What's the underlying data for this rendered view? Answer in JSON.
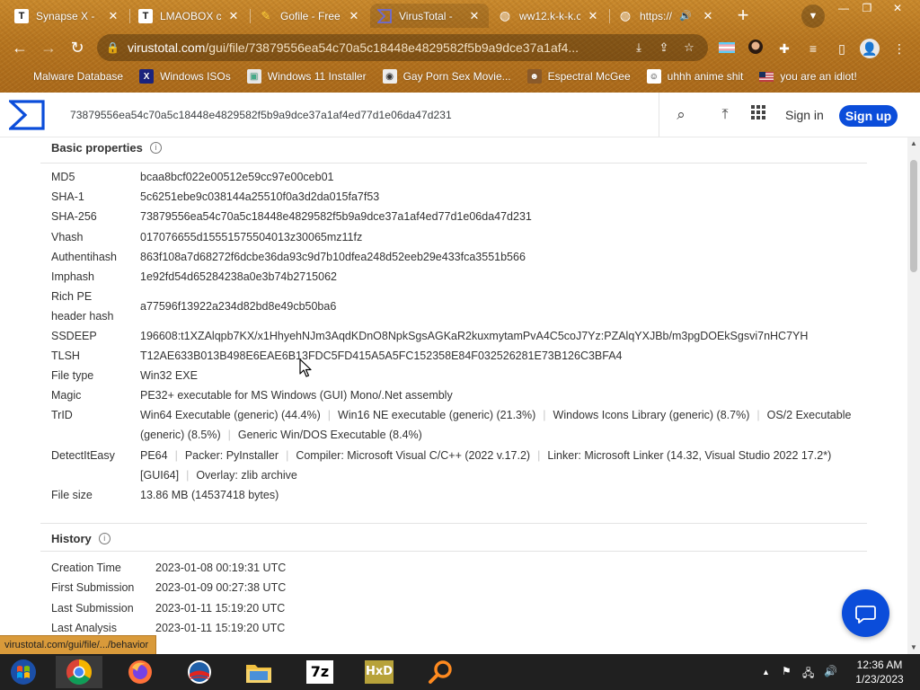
{
  "browser": {
    "tabs": [
      {
        "title": "Synapse X -",
        "favicon": "T"
      },
      {
        "title": "LMAOBOX c",
        "favicon": "T"
      },
      {
        "title": "Gofile - Free",
        "favicon": "gofile-icon"
      },
      {
        "title": "VirusTotal -",
        "favicon": "virustotal-icon"
      },
      {
        "title": "ww12.k-k-k.c",
        "favicon": "globe-icon"
      },
      {
        "title": "https://",
        "favicon": "globe-icon"
      }
    ],
    "url_host": "virustotal.com",
    "url_path": "/gui/file/73879556ea54c70a5c18448e4829582f5b9a9dce37a1af4...",
    "bookmarks": [
      {
        "label": "Malware Database",
        "icon": "folder-icon"
      },
      {
        "label": "Windows ISOs",
        "icon": "x-icon"
      },
      {
        "label": "Windows 11 Installer",
        "icon": "image-icon"
      },
      {
        "label": "Gay Porn Sex Movie...",
        "icon": "site-icon"
      },
      {
        "label": "Espectral McGee",
        "icon": "site-icon"
      },
      {
        "label": "uhhh anime shit",
        "icon": "site-icon"
      },
      {
        "label": "you are an idiot!",
        "icon": "flag-icon"
      }
    ],
    "status_url": "virustotal.com/gui/file/.../behavior"
  },
  "vt": {
    "search_value": "73879556ea54c70a5c18448e4829582f5b9a9dce37a1af4ed77d1e06da47d231",
    "signin": "Sign in",
    "signup": "Sign up",
    "basic_title": "Basic properties",
    "props": [
      {
        "label": "MD5",
        "value": "bcaa8bcf022e00512e59cc97e00ceb01"
      },
      {
        "label": "SHA-1",
        "value": "5c6251ebe9c038144a25510f0a3d2da015fa7f53"
      },
      {
        "label": "SHA-256",
        "value": "73879556ea54c70a5c18448e4829582f5b9a9dce37a1af4ed77d1e06da47d231"
      },
      {
        "label": "Vhash",
        "value": "017076655d15551575504013z30065mz11fz"
      },
      {
        "label": "Authentihash",
        "value": "863f108a7d68272f6dcbe36da93c9d7b10dfea248d52eeb29e433fca3551b566"
      },
      {
        "label": "Imphash",
        "value": "1e92fd54d65284238a0e3b74b2715062"
      },
      {
        "label": "Rich PE header hash",
        "label1": "Rich PE",
        "label2": "header hash",
        "value": "a77596f13922a234d82bd8e49cb50ba6"
      },
      {
        "label": "SSDEEP",
        "value": "196608:t1XZAlqpb7KX/x1HhyehNJm3AqdKDnO8NpkSgsAGKaR2kuxmytamPvA4C5coJ7Yz:PZAlqYXJBb/m3pgDOEkSgsvi7nHC7YH"
      },
      {
        "label": "TLSH",
        "value": "T12AE633B013B498E6EAE6B13FDC5FD415A5A5FC152358E84F032526281E73B126C3BFA4"
      },
      {
        "label": "File type",
        "value": "Win32 EXE"
      },
      {
        "label": "Magic",
        "value": "PE32+ executable for MS Windows (GUI) Mono/.Net assembly"
      }
    ],
    "trid_label": "TrID",
    "trid": [
      "Win64 Executable (generic) (44.4%)",
      "Win16 NE executable (generic) (21.3%)",
      "Windows Icons Library (generic) (8.7%)",
      "OS/2 Executable (generic) (8.5%)",
      "Generic Win/DOS Executable (8.4%)"
    ],
    "die_label": "DetectItEasy",
    "die": [
      "PE64",
      "Packer: PyInstaller",
      "Compiler: Microsoft Visual C/C++ (2022 v.17.2)",
      "Linker: Microsoft Linker (14.32, Visual Studio 2022 17.2*) [GUI64]",
      "Overlay: zlib archive"
    ],
    "filesize_label": "File size",
    "filesize": "13.86 MB (14537418 bytes)",
    "history_title": "History",
    "history": [
      {
        "label": "Creation Time",
        "value": "2023-01-08 00:19:31 UTC"
      },
      {
        "label": "First Submission",
        "value": "2023-01-09 00:27:38 UTC"
      },
      {
        "label": "Last Submission",
        "value": "2023-01-11 15:19:20 UTC"
      },
      {
        "label": "Last Analysis",
        "value": "2023-01-11 15:19:20 UTC"
      }
    ],
    "accent": "#0b4dda"
  },
  "taskbar": {
    "time": "12:36 AM",
    "date": "1/23/2023",
    "apps": [
      "start-icon",
      "chrome-icon",
      "firefox-icon",
      "obama-icon",
      "file-explorer-icon",
      "7zip-icon",
      "hxd-icon",
      "search-icon"
    ],
    "sevenzip_label": "7z",
    "hxd_label": "HxD"
  }
}
